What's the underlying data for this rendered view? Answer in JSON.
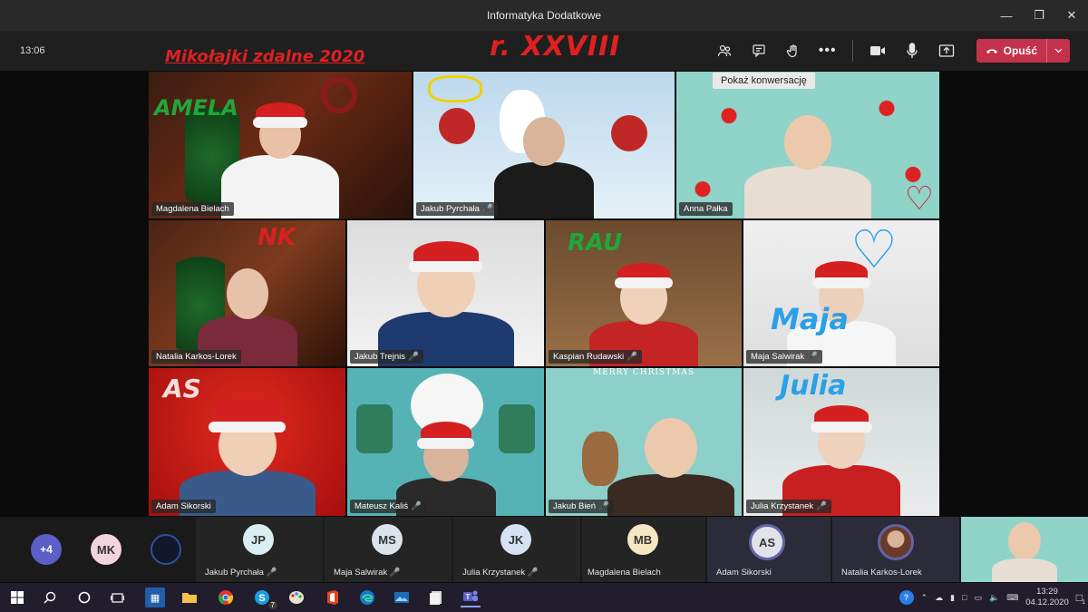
{
  "window": {
    "title": "Informatyka Dodatkowe"
  },
  "toolbar": {
    "clock": "13:06",
    "leave_label": "Opuść",
    "tooltip": "Pokaż konwersację",
    "icons": [
      "participants-icon",
      "chat-icon",
      "raise-hand-icon",
      "more-icon",
      "camera-icon",
      "mic-icon",
      "share-icon"
    ]
  },
  "annotations": {
    "banner": "Mikołajki zdalne 2020",
    "class_mark": "r. XXVIII",
    "tile1_ink": "AMELA",
    "tile4_ink": "NK",
    "tile6_ink": "RAU",
    "tile7_ink": "Maja",
    "tile8_ink": "AS",
    "tile11_ink": "Julia",
    "tile_merry": "MERRY CHRISTMAS"
  },
  "tiles": [
    {
      "name": "Magdalena Bielach",
      "mic": false
    },
    {
      "name": "Jakub Pyrchała",
      "mic": true
    },
    {
      "name": "Anna Pałka",
      "mic": false
    },
    {
      "name": "Natalia Karkos-Lorek",
      "mic": false
    },
    {
      "name": "Jakub Trejnis",
      "mic": true
    },
    {
      "name": "Kaspian Rudawski",
      "mic": true
    },
    {
      "name": "Maja Salwirak",
      "mic": true
    },
    {
      "name": "Adam Sikorski",
      "mic": false
    },
    {
      "name": "Mateusz Kaliś",
      "mic": true
    },
    {
      "name": "Jakub Bień",
      "mic": true
    },
    {
      "name": "Julia Krzystanek",
      "mic": true
    }
  ],
  "stripe": {
    "overflow": "+4",
    "items": [
      {
        "initials": "MK",
        "label": ""
      },
      {
        "initials": "",
        "label": ""
      },
      {
        "initials": "JP",
        "label": "Jakub Pyrchała"
      },
      {
        "initials": "MS",
        "label": "Maja Salwirak"
      },
      {
        "initials": "JK",
        "label": "Julia Krzystanek"
      },
      {
        "initials": "MB",
        "label": "Magdalena Bielach"
      },
      {
        "initials": "AS",
        "label": "Adam Sikorski"
      },
      {
        "initials": "",
        "label": "Natalia Karkos-Lorek"
      }
    ]
  },
  "taskbar": {
    "time": "13:29",
    "date": "04.12.2020",
    "skype_badge": "7",
    "notif_badge": "1",
    "colors": {
      "accent": "#c4314b",
      "taskbar": "#221d2c"
    }
  }
}
